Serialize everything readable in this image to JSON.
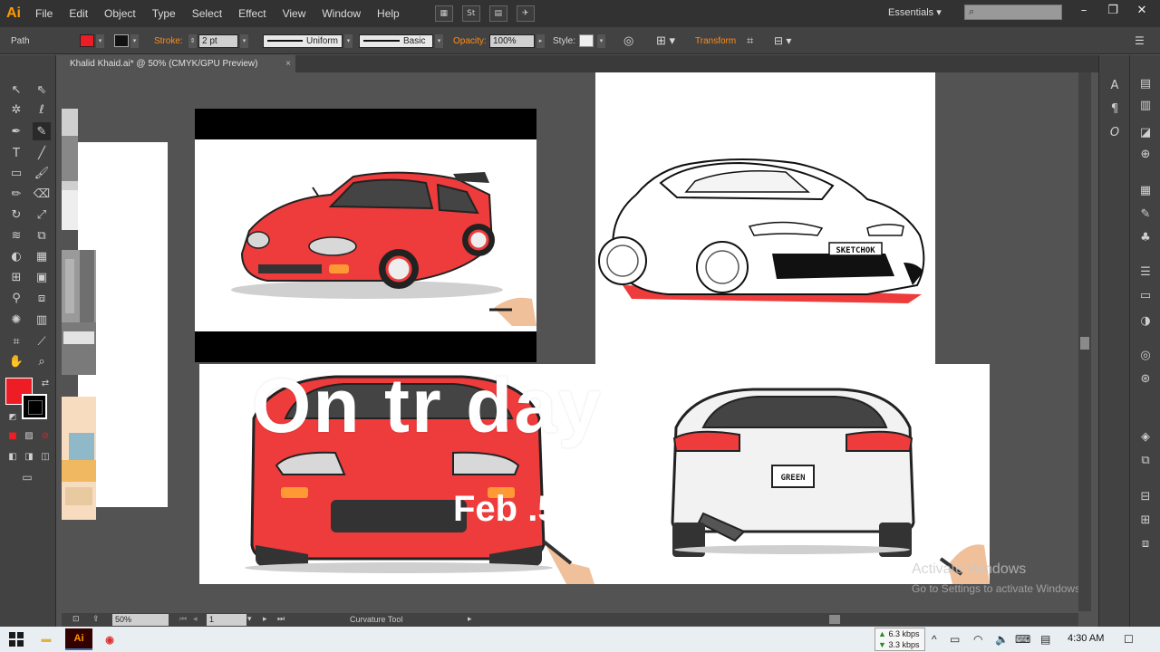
{
  "app": {
    "logo": "Ai",
    "menu": [
      "File",
      "Edit",
      "Object",
      "Type",
      "Select",
      "Effect",
      "View",
      "Window",
      "Help"
    ],
    "workspace": "Essentials",
    "accent": "#ff9a00"
  },
  "control_bar": {
    "selection_type": "Path",
    "fill_color": "#ee1c25",
    "stroke_label": "Stroke:",
    "stroke_weight": "2 pt",
    "profile": "Uniform",
    "brush": "Basic",
    "opacity_label": "Opacity:",
    "opacity_value": "100%",
    "style_label": "Style:",
    "transform_label": "Transform"
  },
  "document": {
    "tab_title": "Khalid Khaid.ai* @ 50% (CMYK/GPU Preview)",
    "tab_close": "×"
  },
  "canvas": {
    "overlay_text": "On tr     day",
    "overlay_date": "Feb        .5",
    "license_front": "SKETCHOK",
    "license_rear": "GREEN",
    "watermark_title": "Activate Windows",
    "watermark_sub": "Go to Settings to activate Windows."
  },
  "status_bar": {
    "zoom": "50%",
    "page": "1",
    "tool_name": "Curvature Tool"
  },
  "taskbar": {
    "net_up": "6.3 kbps",
    "net_down": "3.3 kbps",
    "time": "4:30 AM"
  },
  "colors": {
    "car_red": "#ee3b3b",
    "chrome_bg": "#535353",
    "panel_bg": "#424242"
  }
}
